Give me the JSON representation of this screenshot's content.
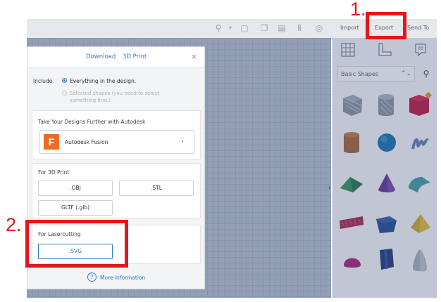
{
  "toolbar": {
    "nav": {
      "import": "Import",
      "export": "Export",
      "send_to": "Send To"
    }
  },
  "dialog": {
    "tabs": {
      "download": "Download",
      "print3d": "3D Print"
    },
    "close": "×",
    "include": {
      "label": "Include",
      "option_all": "Everything in the design.",
      "option_selected": "Selected shapes (you need to select something first.)"
    },
    "autodesk": {
      "title": "Take Your Designs Further with Autodesk",
      "fusion_logo": "F",
      "fusion_label": "Autodesk Fusion",
      "chevron": "›"
    },
    "print3d_section": {
      "title": "For 3D Print",
      "obj": ".OBJ",
      "stl": ".STL",
      "gltf": "GLTF (.glb)"
    },
    "laser": {
      "title": "For Lasercutting",
      "svg": ".SVG"
    },
    "more_info": "More information",
    "info_icon": "?"
  },
  "right_panel": {
    "shape_category": "Basic Shapes",
    "chevron": "⌃⌄",
    "search_icon": "⚲",
    "collapse_chevron": "›"
  },
  "annotations": {
    "step1": "1.",
    "step2": "2.",
    "color": "#e8141b"
  },
  "colors": {
    "accent": "#2b7bd1",
    "fusion": "#f06b21"
  }
}
